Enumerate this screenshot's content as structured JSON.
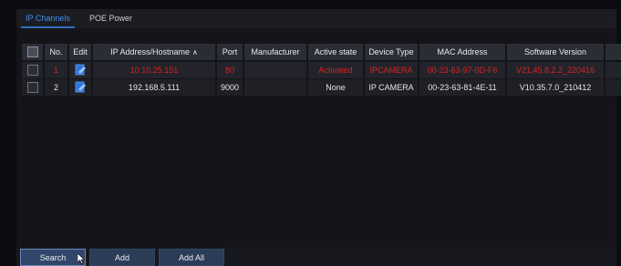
{
  "tabs": [
    {
      "label": "IP Channels",
      "active": true
    },
    {
      "label": "POE Power",
      "active": false
    }
  ],
  "table": {
    "headers": {
      "select": "",
      "no": "No.",
      "edit": "Edit",
      "ip": "IP Address/Hostname",
      "port": "Port",
      "manufacturer": "Manufacturer",
      "active_state": "Active state",
      "device_type": "Device Type",
      "mac": "MAC Address",
      "software": "Software Version"
    },
    "sort_icon": "sort-ascending-icon",
    "rows": [
      {
        "no": "1",
        "ip": "10.10.25.151",
        "port": "80",
        "manufacturer": "",
        "active_state": "Activated",
        "device_type": "IPCAMERA",
        "mac": "00-23-63-97-0D-F6",
        "software": "V21.45.8.2.2_220416",
        "highlight_color": "#d42323"
      },
      {
        "no": "2",
        "ip": "192.168.5.111",
        "port": "9000",
        "manufacturer": "",
        "active_state": "None",
        "device_type": "IP CAMERA",
        "mac": "00-23-63-81-4E-11",
        "software": "V10.35.7.0_210412",
        "highlight_color": "#e4e5e8"
      }
    ]
  },
  "buttons": {
    "search": "Search",
    "add": "Add",
    "add_all": "Add All"
  },
  "colors": {
    "accent": "#3f8fe8",
    "button": "#2b3c57",
    "error_row": "#d42323"
  }
}
